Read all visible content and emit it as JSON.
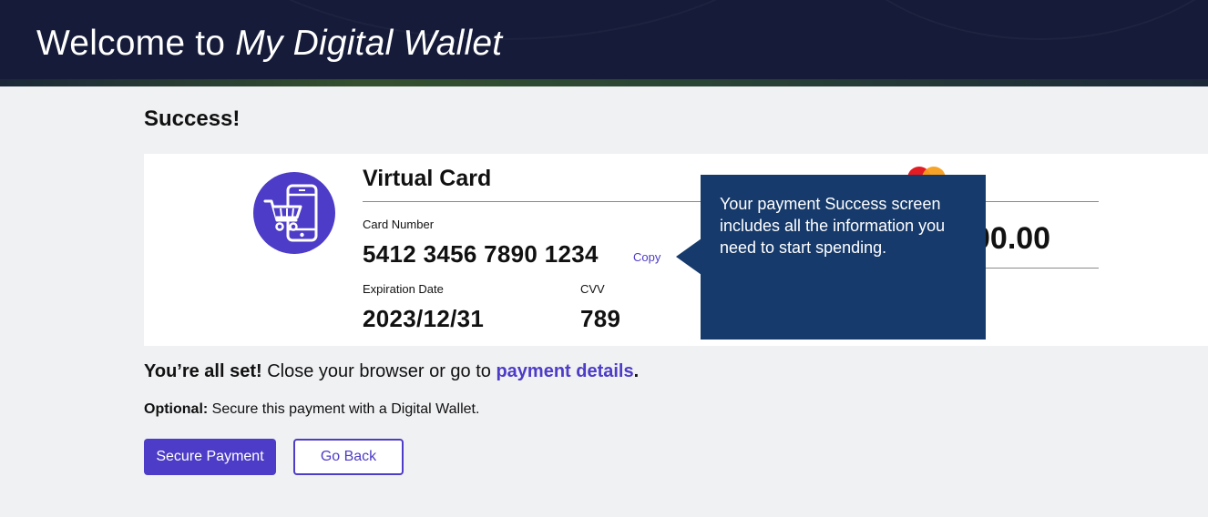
{
  "header": {
    "title_prefix": "Welcome to ",
    "title_brand": "My Digital Wallet"
  },
  "success_heading": "Success!",
  "card": {
    "title": "Virtual Card",
    "card_number_label": "Card Number",
    "card_number": "5412 3456 7890 1234",
    "copy_label": "Copy",
    "expiration_label": "Expiration Date",
    "expiration": "2023/12/31",
    "cvv_label": "CVV",
    "cvv": "789",
    "amount_visible": "00.00",
    "network_logo": "mastercard-logo",
    "icon": "mobile-cart-icon"
  },
  "tooltip": {
    "text": "Your payment Success screen includes all the information you need to start spending."
  },
  "status": {
    "all_set_bold": "You’re all set!",
    "all_set_text": " Close your browser or go to ",
    "payment_details_link": "payment details",
    "period": "."
  },
  "optional": {
    "label": "Optional:",
    "text": " Secure this payment with a Digital Wallet."
  },
  "buttons": {
    "secure_payment": "Secure Payment",
    "go_back": "Go Back"
  },
  "colors": {
    "header_bg": "#151b38",
    "accent": "#4d3cc7",
    "tooltip_bg": "#163a6b",
    "page_bg": "#f0f1f3"
  }
}
